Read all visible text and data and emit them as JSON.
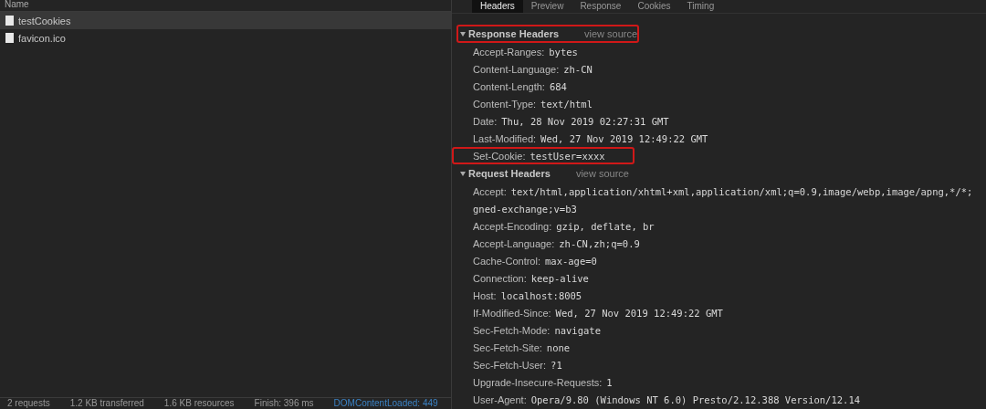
{
  "requests": {
    "column_header": "Name",
    "rows": [
      {
        "name": "testCookies",
        "selected": true
      },
      {
        "name": "favicon.ico",
        "selected": false
      }
    ]
  },
  "status_bar": [
    {
      "text": "2 requests",
      "kind": "plain"
    },
    {
      "text": "1.2 KB transferred",
      "kind": "plain"
    },
    {
      "text": "1.6 KB resources",
      "kind": "plain"
    },
    {
      "text": "Finish: 396 ms",
      "kind": "plain"
    },
    {
      "text": "DOMContentLoaded: 449",
      "kind": "link"
    }
  ],
  "tabs": [
    {
      "label": "Headers",
      "selected": true
    },
    {
      "label": "Preview",
      "selected": false
    },
    {
      "label": "Response",
      "selected": false
    },
    {
      "label": "Cookies",
      "selected": false
    },
    {
      "label": "Timing",
      "selected": false
    }
  ],
  "sections": [
    {
      "title": "Response Headers",
      "link": "view source",
      "expanded": true,
      "highlighted": true,
      "headers": [
        {
          "name": "Accept-Ranges:",
          "value": "bytes",
          "highlighted": false
        },
        {
          "name": "Content-Language:",
          "value": "zh-CN",
          "highlighted": false
        },
        {
          "name": "Content-Length:",
          "value": "684",
          "highlighted": false
        },
        {
          "name": "Content-Type:",
          "value": "text/html",
          "highlighted": false
        },
        {
          "name": "Date:",
          "value": "Thu, 28 Nov 2019 02:27:31 GMT",
          "highlighted": false
        },
        {
          "name": "Last-Modified:",
          "value": "Wed, 27 Nov 2019 12:49:22 GMT",
          "highlighted": false
        },
        {
          "name": "Set-Cookie:",
          "value": "testUser=xxxx",
          "highlighted": true
        }
      ]
    },
    {
      "title": "Request Headers",
      "link": "view source",
      "expanded": true,
      "highlighted": false,
      "headers": [
        {
          "name": "Accept:",
          "value": "text/html,application/xhtml+xml,application/xml;q=0.9,image/webp,image/apng,*/*;",
          "continuation": "gned-exchange;v=b3",
          "highlighted": false
        },
        {
          "name": "Accept-Encoding:",
          "value": "gzip, deflate, br",
          "highlighted": false
        },
        {
          "name": "Accept-Language:",
          "value": "zh-CN,zh;q=0.9",
          "highlighted": false
        },
        {
          "name": "Cache-Control:",
          "value": "max-age=0",
          "highlighted": false
        },
        {
          "name": "Connection:",
          "value": "keep-alive",
          "highlighted": false
        },
        {
          "name": "Host:",
          "value": "localhost:8005",
          "highlighted": false
        },
        {
          "name": "If-Modified-Since:",
          "value": "Wed, 27 Nov 2019 12:49:22 GMT",
          "highlighted": false
        },
        {
          "name": "Sec-Fetch-Mode:",
          "value": "navigate",
          "highlighted": false
        },
        {
          "name": "Sec-Fetch-Site:",
          "value": "none",
          "highlighted": false
        },
        {
          "name": "Sec-Fetch-User:",
          "value": "?1",
          "highlighted": false
        },
        {
          "name": "Upgrade-Insecure-Requests:",
          "value": "1",
          "highlighted": false
        },
        {
          "name": "User-Agent:",
          "value": "Opera/9.80 (Windows NT 6.0) Presto/2.12.388 Version/12.14",
          "highlighted": false
        }
      ]
    }
  ]
}
